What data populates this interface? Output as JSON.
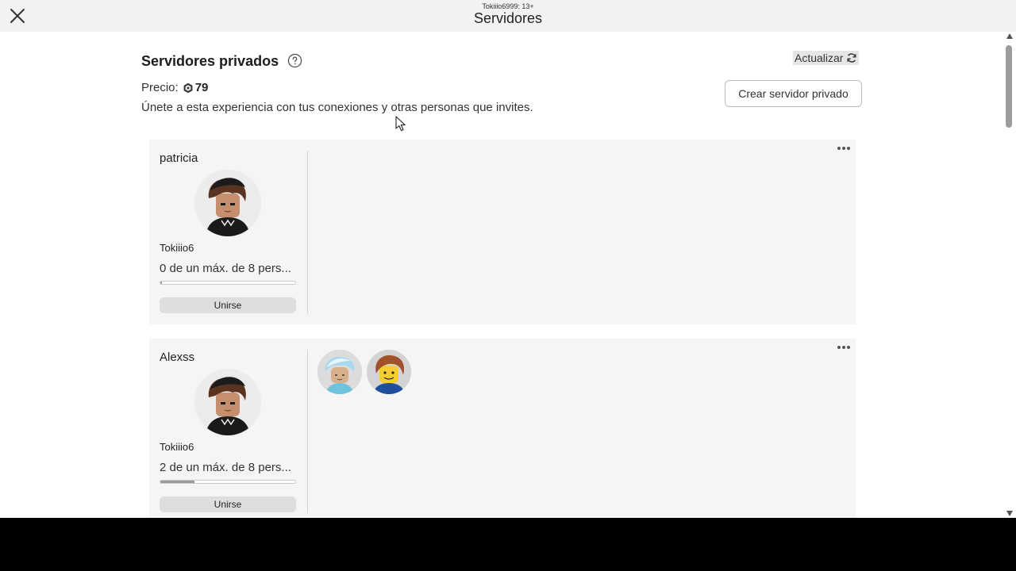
{
  "window": {
    "subtitle": "Tokiiio6999: 13+",
    "title": "Servidores",
    "close_icon": "close-icon"
  },
  "header": {
    "title": "Servidores privados",
    "help_icon": "help-circle-icon",
    "price_label": "Precio:",
    "price_value": "79",
    "currency_icon": "robux-icon",
    "description": "Únete a esta experiencia con tus conexiones y otras personas que invites.",
    "refresh_label": "Actualizar",
    "refresh_icon": "refresh-icon",
    "create_label": "Crear servidor privado"
  },
  "servers": [
    {
      "name": "patricia",
      "host": "Tokiiio6",
      "players_text": "0 de un máx. de 8 pers...",
      "fill_fraction": 0.0,
      "join_label": "Unirse",
      "player_avatars": []
    },
    {
      "name": "Alexss",
      "host": "Tokiiio6",
      "players_text": "2 de un máx. de 8 pers...",
      "fill_fraction": 0.25,
      "join_label": "Unirse",
      "player_avatars": [
        "avatar-blue-hair",
        "avatar-classic-brown-hair"
      ]
    }
  ],
  "colors": {
    "topbar_bg": "#f2f2f3",
    "card_bg": "#f5f5f6",
    "button_bg": "#dedee0",
    "progress_fill": "#9a9a9a"
  }
}
